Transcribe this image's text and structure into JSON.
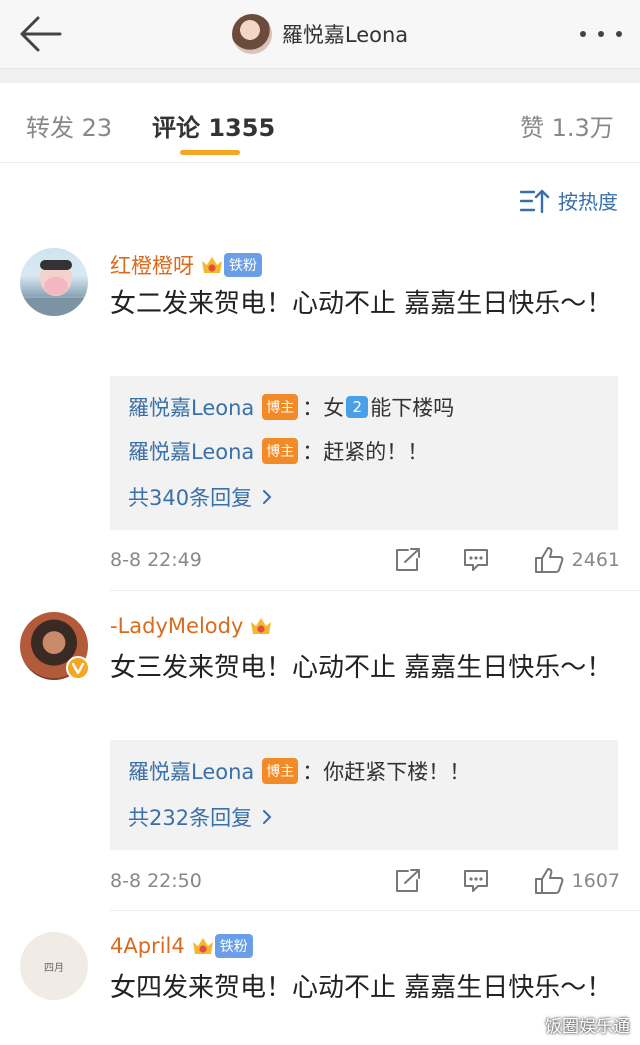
{
  "header": {
    "title": "羅悦嘉Leona"
  },
  "tabs": [
    {
      "label": "转发 23"
    },
    {
      "label": "评论 1355"
    },
    {
      "label": "赞 1.3万"
    }
  ],
  "sort": {
    "label": "按热度"
  },
  "comments": [
    {
      "username": "红橙橙呀",
      "crown_level": "6",
      "fan_badge": "铁粉",
      "text": "女二发来贺电！心动不止 嘉嘉生日快乐～！",
      "replies": [
        {
          "name": "羅悦嘉Leona",
          "badge": "博主",
          "prefix": "：女",
          "num": "2",
          "suffix": "能下楼吗"
        },
        {
          "name": "羅悦嘉Leona",
          "badge": "博主",
          "text": "：赶紧的！！"
        }
      ],
      "reply_count": "共340条回复",
      "time": "8-8 22:49",
      "likes": "2461"
    },
    {
      "username": "-LadyMelody",
      "crown_level": "6",
      "text": "女三发来贺电！心动不止 嘉嘉生日快乐～！",
      "replies": [
        {
          "name": "羅悦嘉Leona",
          "badge": "博主",
          "text": "：你赶紧下楼！！"
        }
      ],
      "reply_count": "共232条回复",
      "time": "8-8 22:50",
      "likes": "1607"
    },
    {
      "username": "4April4",
      "crown_level": "6",
      "fan_badge": "铁粉",
      "avatar_text": "四月",
      "text": "女四发来贺电！心动不止 嘉嘉生日快乐～！"
    }
  ],
  "watermark": "饭圈娱乐通",
  "colors": {
    "username": "#d96b1f",
    "link": "#3a70a8",
    "tab_accent": "#f5a623",
    "blogger_badge": "#f28a27",
    "fan_badge": "#6a9ee6"
  }
}
